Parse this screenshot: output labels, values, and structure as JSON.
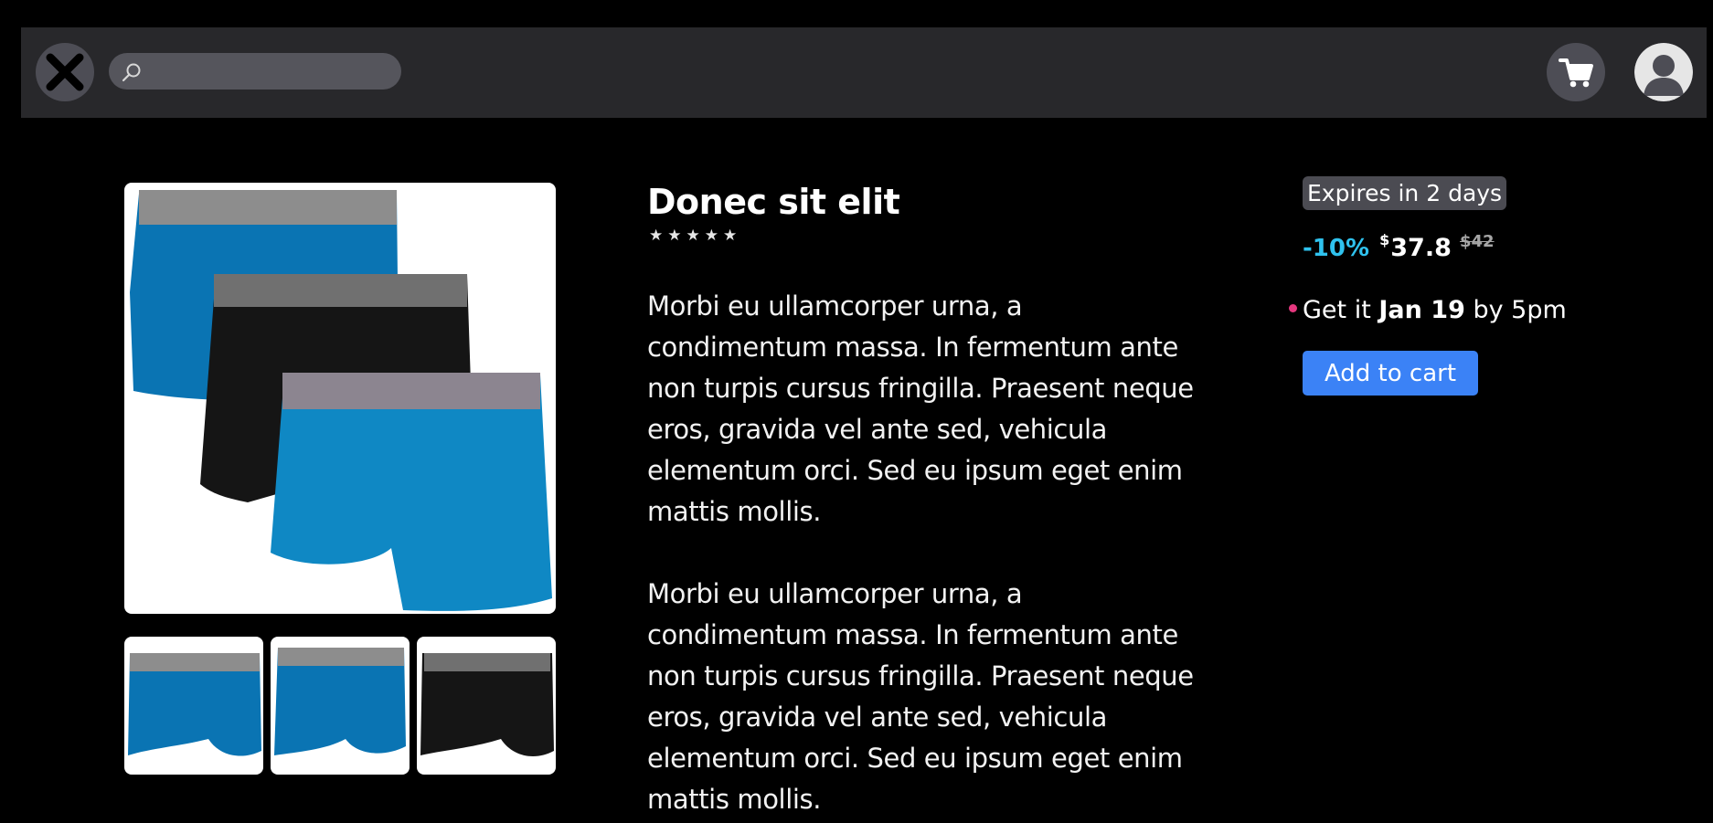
{
  "header": {
    "logo_icon": "close-x-logo-icon",
    "search": {
      "placeholder": "",
      "value": "",
      "icon": "search-icon"
    },
    "cart_icon": "cart-icon",
    "avatar_icon": "user-avatar-icon"
  },
  "gallery": {
    "main_image": "boxer-briefs-3-pack-image",
    "thumbnails": [
      "blue-boxer-front-thumbnail",
      "blue-boxer-back-thumbnail",
      "black-boxer-thumbnail"
    ]
  },
  "product": {
    "title": "Donec sit elit",
    "rating": {
      "stars": 5,
      "max": 5
    },
    "description": [
      "Morbi eu ullamcorper urna, a condimentum massa. In fermentum ante non turpis cursus fringilla. Praesent neque eros, gravida vel ante sed, vehicula elementum orci. Sed eu ipsum eget enim mattis mollis.",
      "Morbi eu ullamcorper urna, a condimentum massa. In fermentum ante non turpis cursus fringilla. Praesent neque eros, gravida vel ante sed, vehicula elementum orci. Sed eu ipsum eget enim mattis mollis."
    ]
  },
  "purchase": {
    "expires": "Expires in 2 days",
    "discount": "-10%",
    "currency": "$",
    "price": "37.8",
    "old_price": "$42",
    "delivery_prefix": "Get it",
    "delivery_date": "Jan 19",
    "delivery_suffix": "by 5pm",
    "add_to_cart": "Add to cart"
  },
  "colors": {
    "background": "#000000",
    "topbar": "#28282b",
    "accent_discount": "#2fc2ee",
    "button": "#3b82f6",
    "delivery_dot": "#e5377e",
    "product_blue": "#0a7bb5",
    "product_black": "#141414"
  }
}
